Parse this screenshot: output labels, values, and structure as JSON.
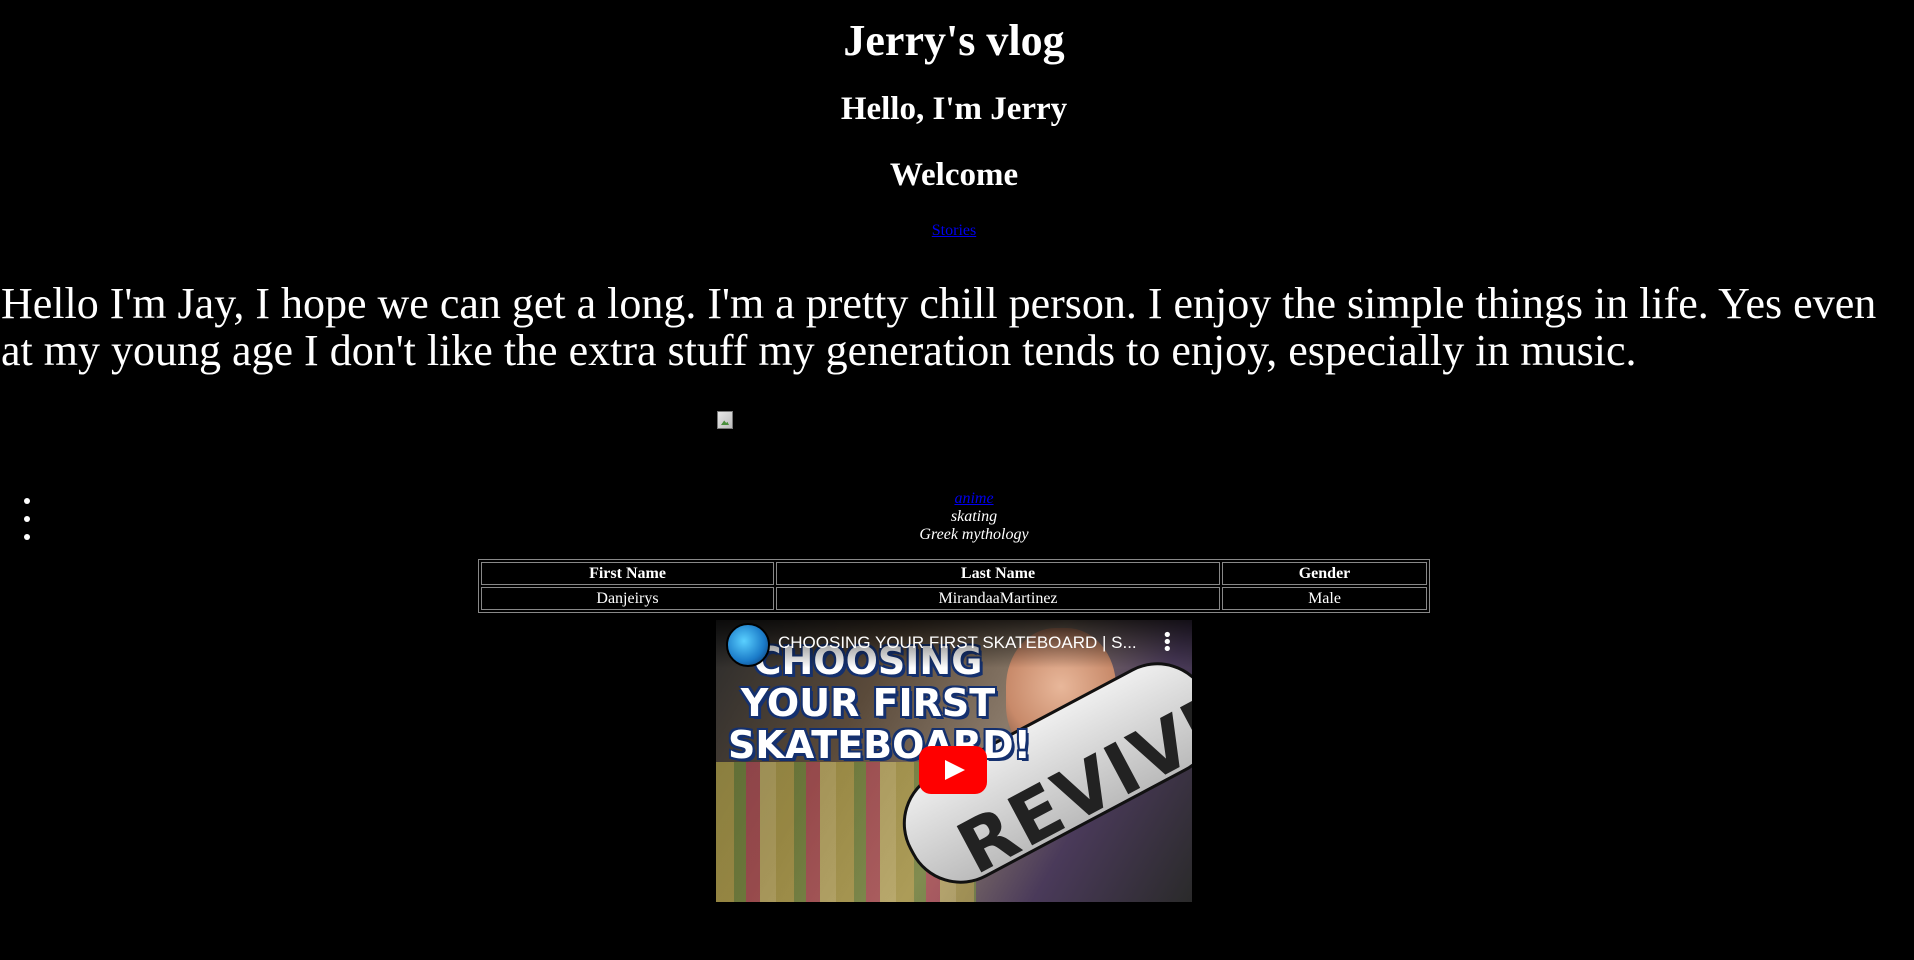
{
  "header": {
    "title": "Jerry's vlog",
    "greeting": "Hello, I'm Jerry",
    "welcome": "Welcome"
  },
  "nav": {
    "stories_link": "Stories"
  },
  "intro": {
    "text": "Hello I'm Jay, I hope we can get a long. I'm a pretty chill person. I enjoy the simple things in life. Yes even at my young age I don't like the extra stuff my generation tends to enjoy, especially in music."
  },
  "hobbies": {
    "items": [
      {
        "label": "anime",
        "is_link": true
      },
      {
        "label": "skating",
        "is_link": false
      },
      {
        "label": "Greek mythology",
        "is_link": false
      }
    ]
  },
  "table": {
    "headers": [
      "First Name",
      "Last Name",
      "Gender"
    ],
    "rows": [
      [
        "Danjeirys",
        "MirandaaMartinez",
        "Male"
      ]
    ]
  },
  "video": {
    "title": "CHOOSING YOUR FIRST SKATEBOARD | S...",
    "thumbnail_text": "CHOOSING YOUR FIRST SKATEBOARD!",
    "board_text": "REVIVE",
    "play_color": "#ff0000"
  },
  "colors": {
    "background": "#000000",
    "text": "#ffffff",
    "link": "#0000ee"
  }
}
